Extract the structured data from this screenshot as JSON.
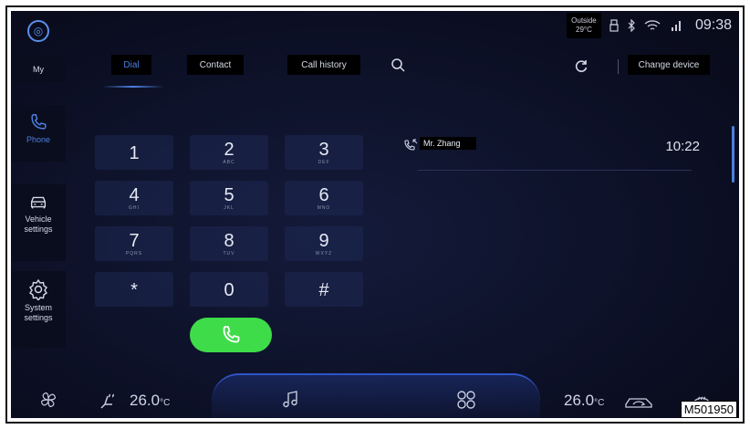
{
  "status": {
    "outside_label": "Outside",
    "outside_temp": "29°C",
    "time": "09:38"
  },
  "sidebar": {
    "my": "My",
    "phone": "Phone",
    "vehicle": "Vehicle settings",
    "system": "System settings"
  },
  "tabs": {
    "dial": "Dial",
    "contact": "Contact",
    "history": "Call history",
    "change_device": "Change device"
  },
  "keypad": [
    {
      "digit": "1",
      "letters": ""
    },
    {
      "digit": "2",
      "letters": "ABC"
    },
    {
      "digit": "3",
      "letters": "DEF"
    },
    {
      "digit": "4",
      "letters": "GHI"
    },
    {
      "digit": "5",
      "letters": "JKL"
    },
    {
      "digit": "6",
      "letters": "MNO"
    },
    {
      "digit": "7",
      "letters": "PQRS"
    },
    {
      "digit": "8",
      "letters": "TUV"
    },
    {
      "digit": "9",
      "letters": "WXYZ"
    },
    {
      "digit": "*",
      "letters": ""
    },
    {
      "digit": "0",
      "letters": ""
    },
    {
      "digit": "#",
      "letters": ""
    }
  ],
  "history": [
    {
      "name": "Mr. Zhang",
      "time": "10:22"
    }
  ],
  "climate": {
    "left_temp": "26.0",
    "right_temp": "26.0",
    "unit": "°C"
  },
  "figure_code": "M501950",
  "accent_color": "#4d7fe0",
  "call_color": "#3fdc4a"
}
